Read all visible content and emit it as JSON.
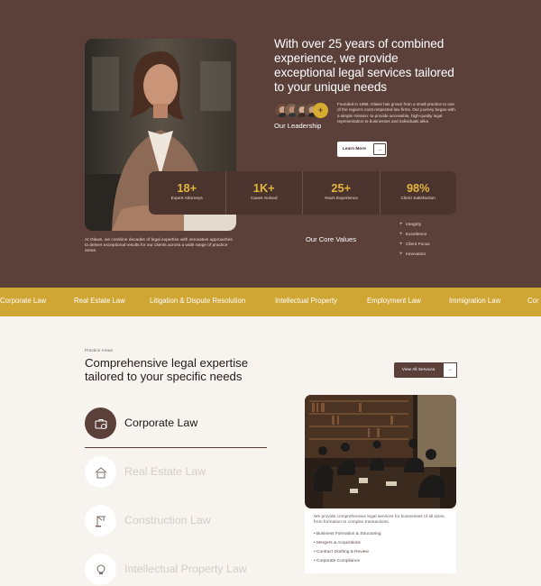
{
  "hero": {
    "headline": "With over 25 years of combined experience, we provide exceptional legal services tailored to your unique needs",
    "leadership_label": "Our Leadership",
    "avatar_more": "+",
    "about_text": "Founded in 1999, Olaws has grown from a small practice to one of the region's most respected law firms. Our journey began with a simple mission: to provide accessible, high-quality legal representation to businesses and individuals alike.",
    "learn_more": "Learn More",
    "learn_more_arrow": "→",
    "left_text": "At Olaws, we combine decades of legal expertise with innovative approaches to deliver exceptional results for our clients across a wide range of practice areas.",
    "core_values_title": "Our Core Values",
    "core_values": [
      "Integrity",
      "Excellence",
      "Client Focus",
      "Innovation"
    ],
    "core_values_bullet": "+"
  },
  "stats": [
    {
      "value": "18+",
      "label": "Expert Attorneys"
    },
    {
      "value": "1K+",
      "label": "Cases Solved"
    },
    {
      "value": "25+",
      "label": "Years Experience"
    },
    {
      "value": "98%",
      "label": "Client Satisfaction"
    }
  ],
  "ticker": [
    "Corporate Law",
    "Real Estate Law",
    "Litigation & Dispute Resolution",
    "Intellectual Property",
    "Employment Law",
    "Immigration Law",
    "Cor"
  ],
  "practice": {
    "label": "Practice Areas",
    "title": "Comprehensive legal expertise tailored to your specific needs",
    "view_all": "View All Services",
    "view_all_arrow": "→",
    "areas": [
      "Corporate Law",
      "Real Estate Law",
      "Construction Law",
      "Intellectual Property Law"
    ],
    "card_desc": "We provide comprehensive legal services for businesses of all sizes, from formation to complex transactions.",
    "card_bullet": "•",
    "card_items": [
      "Business Formation & Structuring",
      "Mergers & Acquisitions",
      "Contract Drafting & Review",
      "Corporate Compliance"
    ]
  },
  "colors": {
    "brown": "#5b4039",
    "stats_bg": "#4c342e",
    "gold": "#cfa534",
    "cream": "#f7f3ee"
  },
  "icons": [
    "arrow-right-icon",
    "briefcase-icon",
    "house-icon",
    "crane-icon",
    "lightbulb-icon"
  ]
}
